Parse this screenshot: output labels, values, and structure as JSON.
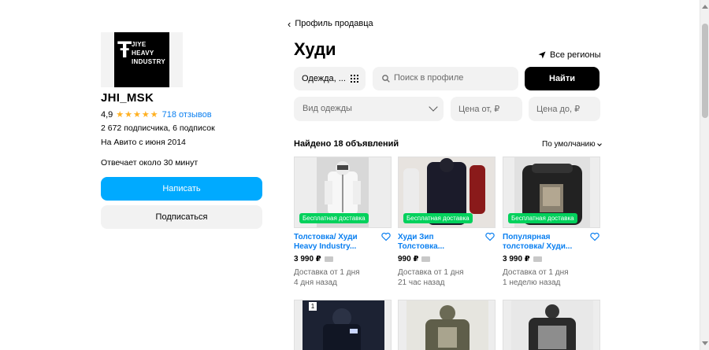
{
  "seller": {
    "logo_text": "JIYE HEAVY INDUSTRY",
    "name": "JHI_MSK",
    "rating": "4,9",
    "stars": "★★★★★",
    "reviews": "718 отзывов",
    "subscribers": "2 672 подписчика, 6 подписок",
    "since": "На Авито с июня 2014",
    "response": "Отвечает около 30 минут",
    "write_label": "Написать",
    "subscribe_label": "Подписаться"
  },
  "header": {
    "back_label": "Профиль продавца",
    "title": "Худи",
    "region_label": "Все регионы"
  },
  "filters": {
    "category_value": "Одежда, ...",
    "search_placeholder": "Поиск в профиле",
    "find_label": "Найти",
    "type_placeholder": "Вид одежды",
    "price_from_placeholder": "Цена от, ₽",
    "price_to_placeholder": "Цена до, ₽"
  },
  "results": {
    "found_label": "Найдено 18 объявлений",
    "sort_label": "По умолчанию"
  },
  "listings": [
    {
      "badge": "Бесплатная доставка",
      "title": "Толстовка/ Худи Heavy Industry...",
      "price": "3 990 ₽",
      "delivery": "Доставка от 1 дня",
      "ago": "4 дня назад"
    },
    {
      "badge": "Бесплатная доставка",
      "title": "Худи Зип Толстовка...",
      "price": "990 ₽",
      "delivery": "Доставка от 1 дня",
      "ago": "21 час назад"
    },
    {
      "badge": "Бесплатная доставка",
      "title": "Популярная толстовка/ Худи...",
      "price": "3 990 ₽",
      "delivery": "Доставка от 1 дня",
      "ago": "1 неделю назад"
    }
  ],
  "row2": {
    "first_badge": "1"
  },
  "colors": {
    "accent": "#00aaff",
    "link": "#0a7ff0",
    "badge": "#02d15c",
    "star": "#ffb021"
  }
}
